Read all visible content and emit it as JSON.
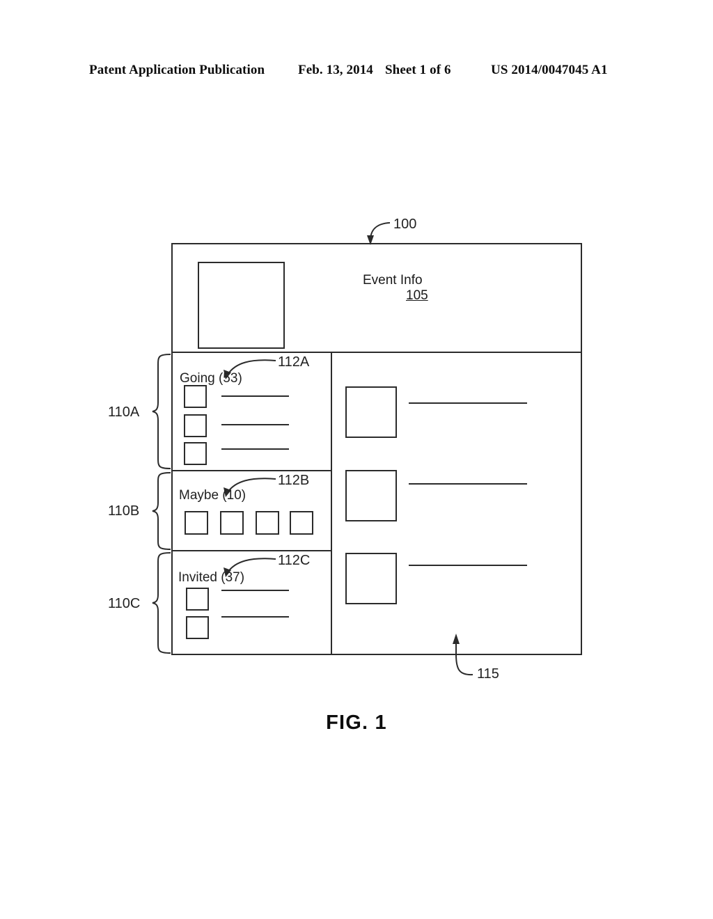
{
  "header": {
    "publication": "Patent Application Publication",
    "date": "Feb. 13, 2014",
    "sheet": "Sheet 1 of 6",
    "patent_number": "US 2014/0047045 A1"
  },
  "figure": {
    "caption": "FIG. 1",
    "interface_ref": "100",
    "feed_panel_ref": "115"
  },
  "event_info": {
    "title": "Event Info",
    "ref": "105"
  },
  "sections": [
    {
      "id": "going",
      "title": "Going (53)",
      "label": "Going",
      "count": "53",
      "ref": "112A",
      "bracket_ref": "110A",
      "rows": 3,
      "layout": "list"
    },
    {
      "id": "maybe",
      "title": "Maybe (10)",
      "label": "Maybe",
      "count": "10",
      "ref": "112B",
      "bracket_ref": "110B",
      "rows": 4,
      "layout": "grid"
    },
    {
      "id": "invited",
      "title": "Invited (37)",
      "label": "Invited",
      "count": "37",
      "ref": "112C",
      "bracket_ref": "110C",
      "rows": 2,
      "layout": "list"
    }
  ],
  "feed": {
    "items": 3
  },
  "colors": {
    "line": "#2b2b2b",
    "text": "#222222",
    "background": "#ffffff"
  }
}
